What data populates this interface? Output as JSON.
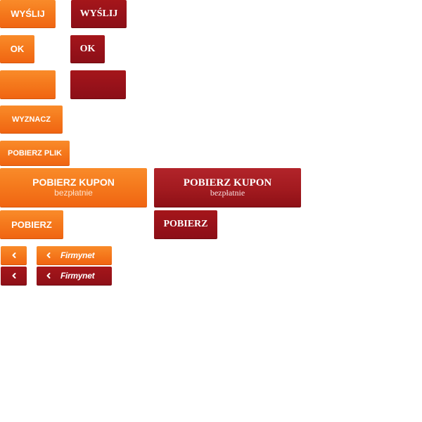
{
  "buttons": {
    "wyslij_orange": "WYŚLIJ",
    "wyslij_red": "WYŚLIJ",
    "ok_orange": "OK",
    "ok_red": "OK",
    "wyznacz": "WYZNACZ",
    "pobierz_plik": "POBIERZ PLIK",
    "kupon_orange": {
      "title": "POBIERZ KUPON",
      "subtitle": "bezpłatnie"
    },
    "kupon_red": {
      "title": "POBIERZ KUPON",
      "subtitle": "bezpłatnie"
    },
    "pobierz_orange": "POBIERZ",
    "pobierz_red": "POBIERZ"
  },
  "nav": {
    "brand_orange": "Firmynet",
    "brand_red": "Firmynet",
    "back_icon": "chevron-left-icon"
  },
  "colors": {
    "orange": "#f57a1d",
    "red": "#98121a",
    "background": "#ffffff"
  }
}
